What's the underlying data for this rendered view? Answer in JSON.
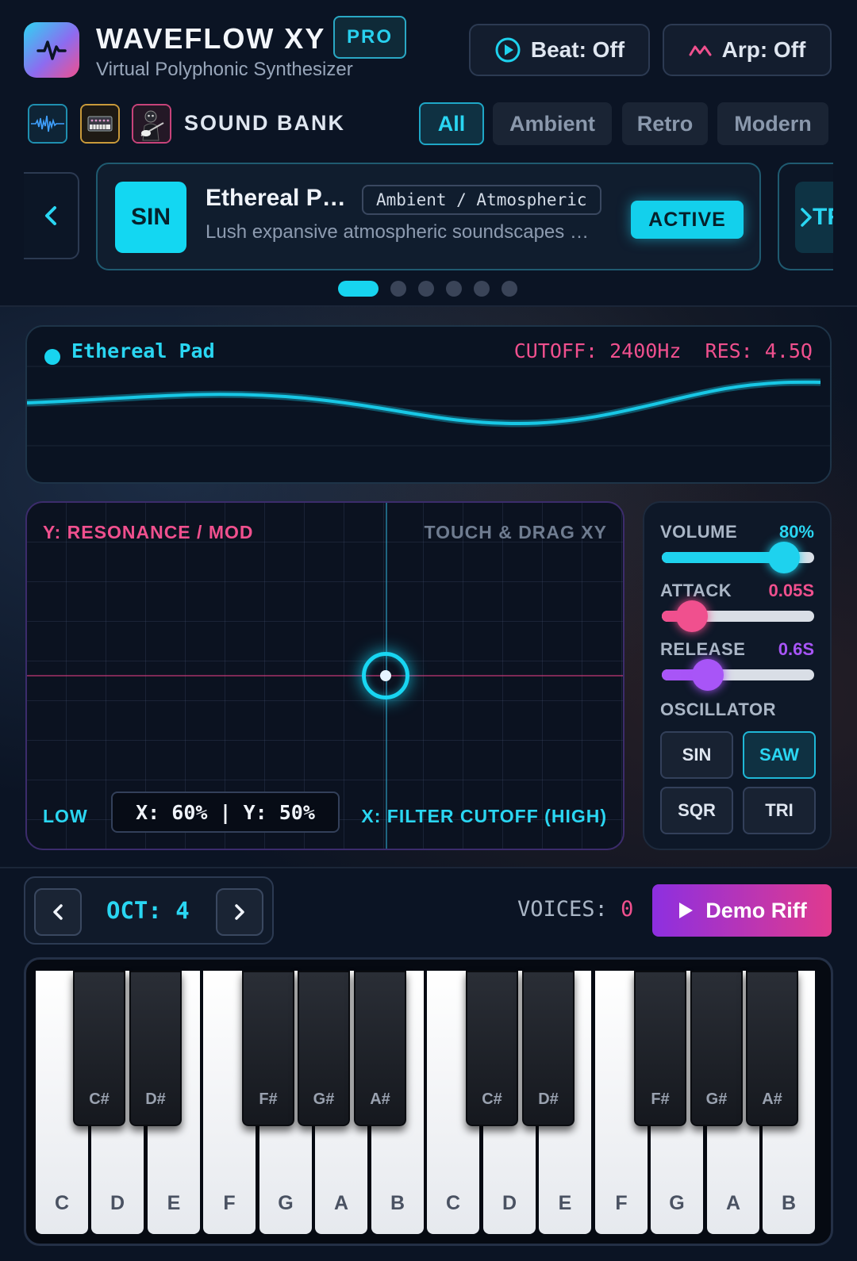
{
  "app": {
    "title": "WAVEFLOW XY",
    "badge": "PRO",
    "subtitle": "Virtual Polyphonic Synthesizer",
    "beat_label": "Beat: Off",
    "arp_label": "Arp: Off"
  },
  "bank": {
    "title": "SOUND BANK",
    "filters": [
      "All",
      "Ambient",
      "Retro",
      "Modern"
    ],
    "selected_filter": "All"
  },
  "preset": {
    "badge": "SIN",
    "name": "Ethereal P…",
    "tag": "Ambient / Atmospheric",
    "description": "Lush expansive atmospheric soundscapes …",
    "status": "ACTIVE",
    "next_badge": "TR",
    "page_count": 6,
    "current_page": 1
  },
  "display": {
    "name": "Ethereal Pad",
    "params": "CUTOFF: 2400Hz  RES: 4.5Q"
  },
  "xy": {
    "y_label": "Y: RESONANCE / MOD",
    "hint": "TOUCH & DRAG XY",
    "low_label": "LOW",
    "readout": "X: 60% | Y: 50%",
    "x_label": "X: FILTER CUTOFF (HIGH)",
    "x_value": 0.6,
    "y_value": 0.5
  },
  "controls": {
    "volume": {
      "label": "VOLUME",
      "value": "80%",
      "level": 0.8,
      "color": "#1ed2ee"
    },
    "attack": {
      "label": "ATTACK",
      "value": "0.05S",
      "level": 0.2,
      "color": "#f0508e"
    },
    "release": {
      "label": "RELEASE",
      "value": "0.6S",
      "level": 0.3,
      "color": "#a855f7"
    },
    "oscillator_label": "OSCILLATOR",
    "oscillators": [
      "SIN",
      "SAW",
      "SQR",
      "TRI"
    ],
    "selected_oscillator": "SAW"
  },
  "octave": {
    "label": "OCT: 4"
  },
  "voices": {
    "label": "VOICES:",
    "count": "0"
  },
  "demo_label": "Demo Riff",
  "keyboard": {
    "white_keys": [
      "C",
      "D",
      "E",
      "F",
      "G",
      "A",
      "B",
      "C",
      "D",
      "E",
      "F",
      "G",
      "A",
      "B"
    ],
    "black_keys": [
      "C#",
      "D#",
      "F#",
      "G#",
      "A#",
      "C#",
      "D#",
      "F#",
      "G#",
      "A#"
    ]
  },
  "colors": {
    "accent": "#18d4f0",
    "pink": "#f0508e",
    "purple": "#a855f7"
  }
}
